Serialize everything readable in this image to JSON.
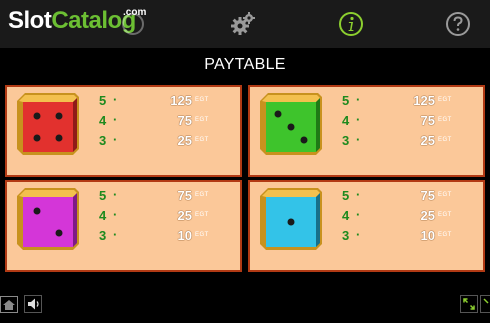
{
  "logo": {
    "part1": "Slot",
    "part2": "Catalog",
    "suffix": ".com"
  },
  "header_icons": [
    "slot-logo-faint-icon",
    "gear-icon",
    "info-icon",
    "help-icon"
  ],
  "title": "PAYTABLE",
  "unit": "EGT",
  "colors": {
    "panel_bg": "#fbc899",
    "panel_border": "#b23a14",
    "count_green": "#1e8a1e",
    "accent_green": "#8ccf2f"
  },
  "panels": [
    {
      "die_color": "red",
      "die_face": 4,
      "rows": [
        {
          "count": "5",
          "amount": "125"
        },
        {
          "count": "4",
          "amount": "75"
        },
        {
          "count": "3",
          "amount": "25"
        }
      ]
    },
    {
      "die_color": "green",
      "die_face": 3,
      "rows": [
        {
          "count": "5",
          "amount": "125"
        },
        {
          "count": "4",
          "amount": "75"
        },
        {
          "count": "3",
          "amount": "25"
        }
      ]
    },
    {
      "die_color": "magenta",
      "die_face": 2,
      "rows": [
        {
          "count": "5",
          "amount": "75"
        },
        {
          "count": "4",
          "amount": "25"
        },
        {
          "count": "3",
          "amount": "10"
        }
      ]
    },
    {
      "die_color": "cyan",
      "die_face": 1,
      "rows": [
        {
          "count": "5",
          "amount": "75"
        },
        {
          "count": "4",
          "amount": "25"
        },
        {
          "count": "3",
          "amount": "10"
        }
      ]
    }
  ],
  "footer_icons": [
    "home-icon",
    "sound-icon",
    "fullscreen-icon",
    "partial-icon"
  ]
}
